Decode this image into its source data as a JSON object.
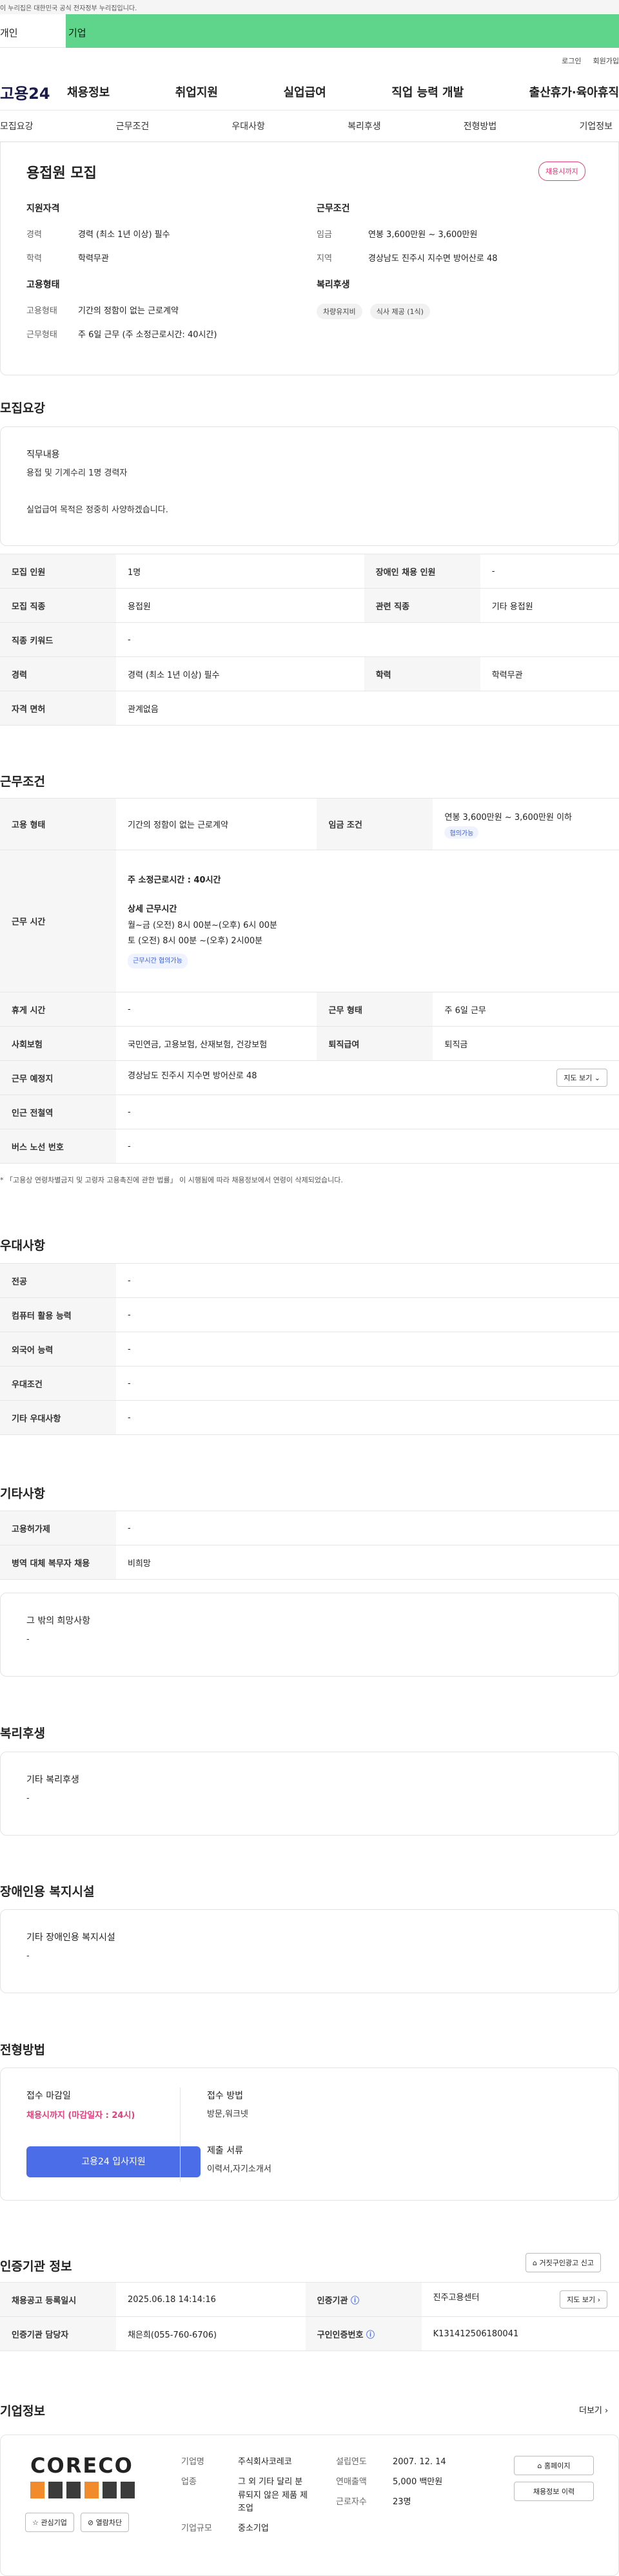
{
  "gov_banner": "이 누리집은 대한민국 공식 전자정부 누리집입니다.",
  "category": {
    "left": "개인",
    "right": "기업"
  },
  "util": {
    "login": "로그인",
    "join": "회원가입"
  },
  "logo": "고용24",
  "gnb": [
    "채용정보",
    "취업지원",
    "실업급여",
    "직업 능력 개발",
    "출산휴가·육아휴직"
  ],
  "tabs": [
    "모집요강",
    "근무조건",
    "우대사항",
    "복리후생",
    "전형방법",
    "기업정보"
  ],
  "summary": {
    "title": "용접원 모집",
    "badge": "채용시까지",
    "qual_head": "지원자격",
    "qual": [
      {
        "k": "경력",
        "v": "경력 (최소 1년 이상) 필수"
      },
      {
        "k": "학력",
        "v": "학력무관"
      }
    ],
    "work_head": "근무조건",
    "work": [
      {
        "k": "임금",
        "v": "연봉 3,600만원 ~ 3,600만원"
      },
      {
        "k": "지역",
        "v": "경상남도 진주시 지수면 방어산로 48"
      }
    ],
    "emp_head": "고용형태",
    "emp": [
      {
        "k": "고용형태",
        "v": "기간의 정함이 없는 근로계약"
      },
      {
        "k": "근무형태",
        "v": "주 6일 근무 (주 소정근로시간: 40시간)"
      }
    ],
    "welfare_head": "복리후생",
    "welfare_chips": [
      "차량유지비",
      "식사 제공 (1식)"
    ]
  },
  "recruit": {
    "title": "모집요강",
    "duty_label": "직무내용",
    "duty_line1": "용접 및 기계수리 1명 경력자",
    "duty_line2": "실업급여 목적은 정중히 사양하겠습니다.",
    "rows": [
      [
        "모집 인원",
        "1명",
        "장애인 채용 인원",
        "-"
      ],
      [
        "모집 직종",
        "용접원",
        "관련 직종",
        "기타 용접원"
      ],
      [
        "직종 키워드",
        "-"
      ],
      [
        "경력",
        "경력 (최소 1년 이상) 필수",
        "학력",
        "학력무관"
      ],
      [
        "자격 면허",
        "관계없음"
      ]
    ]
  },
  "conditions": {
    "title": "근무조건",
    "emp_type_k": "고용 형태",
    "emp_type_v": "기간의 정함이 없는 근로계약",
    "wage_k": "임금 조건",
    "wage_v": "연봉 3,600만원 ~ 3,600만원 이하",
    "wage_chip": "협의가능",
    "hours_k": "근무 시간",
    "hours_main": "주 소정근로시간 : 40시간",
    "hours_detail_head": "상세 근무시간",
    "hours_line1": "월~금 (오전) 8시 00분~(오후) 6시 00분",
    "hours_line2": "토       (오전) 8시 00분 ~(오후) 2시00분",
    "hours_chip": "근무시간 협의가능",
    "rows": [
      [
        "휴게 시간",
        "-",
        "근무 형태",
        "주 6일 근무"
      ],
      [
        "사회보험",
        "국민연금, 고용보험, 산재보험, 건강보험",
        "퇴직급여",
        "퇴직금"
      ],
      [
        "근무 예정지",
        "경상남도 진주시 지수면 방어산로 48"
      ],
      [
        "인근 전철역",
        "-"
      ],
      [
        "버스 노선 번호",
        "-"
      ]
    ],
    "map_btn": "지도 보기",
    "note": "* 「고용상 연령차별금지 및 고령자 고용촉진에 관한 법률」 이 시행됨에 따라 채용정보에서 연령이 삭제되었습니다."
  },
  "preference": {
    "title": "우대사항",
    "rows": [
      [
        "전공",
        "-"
      ],
      [
        "컴퓨터 활용 능력",
        "-"
      ],
      [
        "외국어 능력",
        "-"
      ],
      [
        "우대조건",
        "-"
      ],
      [
        "기타 우대사항",
        "-"
      ]
    ]
  },
  "etc": {
    "title": "기타사항",
    "rows": [
      [
        "고용허가제",
        "-"
      ],
      [
        "병역 대체 복무자 채용",
        "비희망"
      ]
    ],
    "hope_label": "그 밖의 희망사항",
    "hope_val": "-"
  },
  "welfare": {
    "title": "복리후생",
    "label": "기타 복리후생",
    "val": "-"
  },
  "disability": {
    "title": "장애인용 복지시설",
    "label": "기타 장애인용 복지시설",
    "val": "-"
  },
  "selection": {
    "title": "전형방법",
    "deadline_label": "접수 마감일",
    "deadline_val": "채용시까지 (마감일자 : 24시)",
    "apply_btn": "고용24 입사지원",
    "method_label": "접수 방법",
    "method_val": "방문,워크넷",
    "docs_label": "제출 서류",
    "docs_val": "이력서,자기소개서"
  },
  "agency": {
    "title": "인증기관 정보",
    "report_btn": "거짓구인광고 신고",
    "reg_date_k": "채용공고 등록일시",
    "reg_date_v": "2025.06.18 14:14:16",
    "agency_k": "인증기관",
    "agency_v": "진주고용센터",
    "manager_k": "인증기관 담당자",
    "manager_v": "채은희(055-760-6706)",
    "cert_k": "구인인증번호",
    "cert_v": "K131412506180041",
    "map_btn": "지도 보기"
  },
  "company": {
    "title": "기업정보",
    "more": "더보기",
    "logo_text": "CORECO",
    "fav_btn": "관심기업",
    "block_btn": "열람차단",
    "name_k": "기업명",
    "name_v": "주식회사코레코",
    "biz_k": "업종",
    "biz_v": "그 외 기타 달리 분류되지 않은 제품 제조업",
    "size_k": "기업규모",
    "size_v": "중소기업",
    "found_k": "설립연도",
    "found_v": "2007. 12. 14",
    "sales_k": "연매출액",
    "sales_v": "5,000 백만원",
    "emp_k": "근로자수",
    "emp_v": "23명",
    "home_btn": "홈페이지",
    "history_btn": "채용정보 이력"
  },
  "colors": {
    "brand_green": "#5fd48b",
    "accent_blue": "#4c6de8",
    "badge_pink": "#e0417a"
  }
}
